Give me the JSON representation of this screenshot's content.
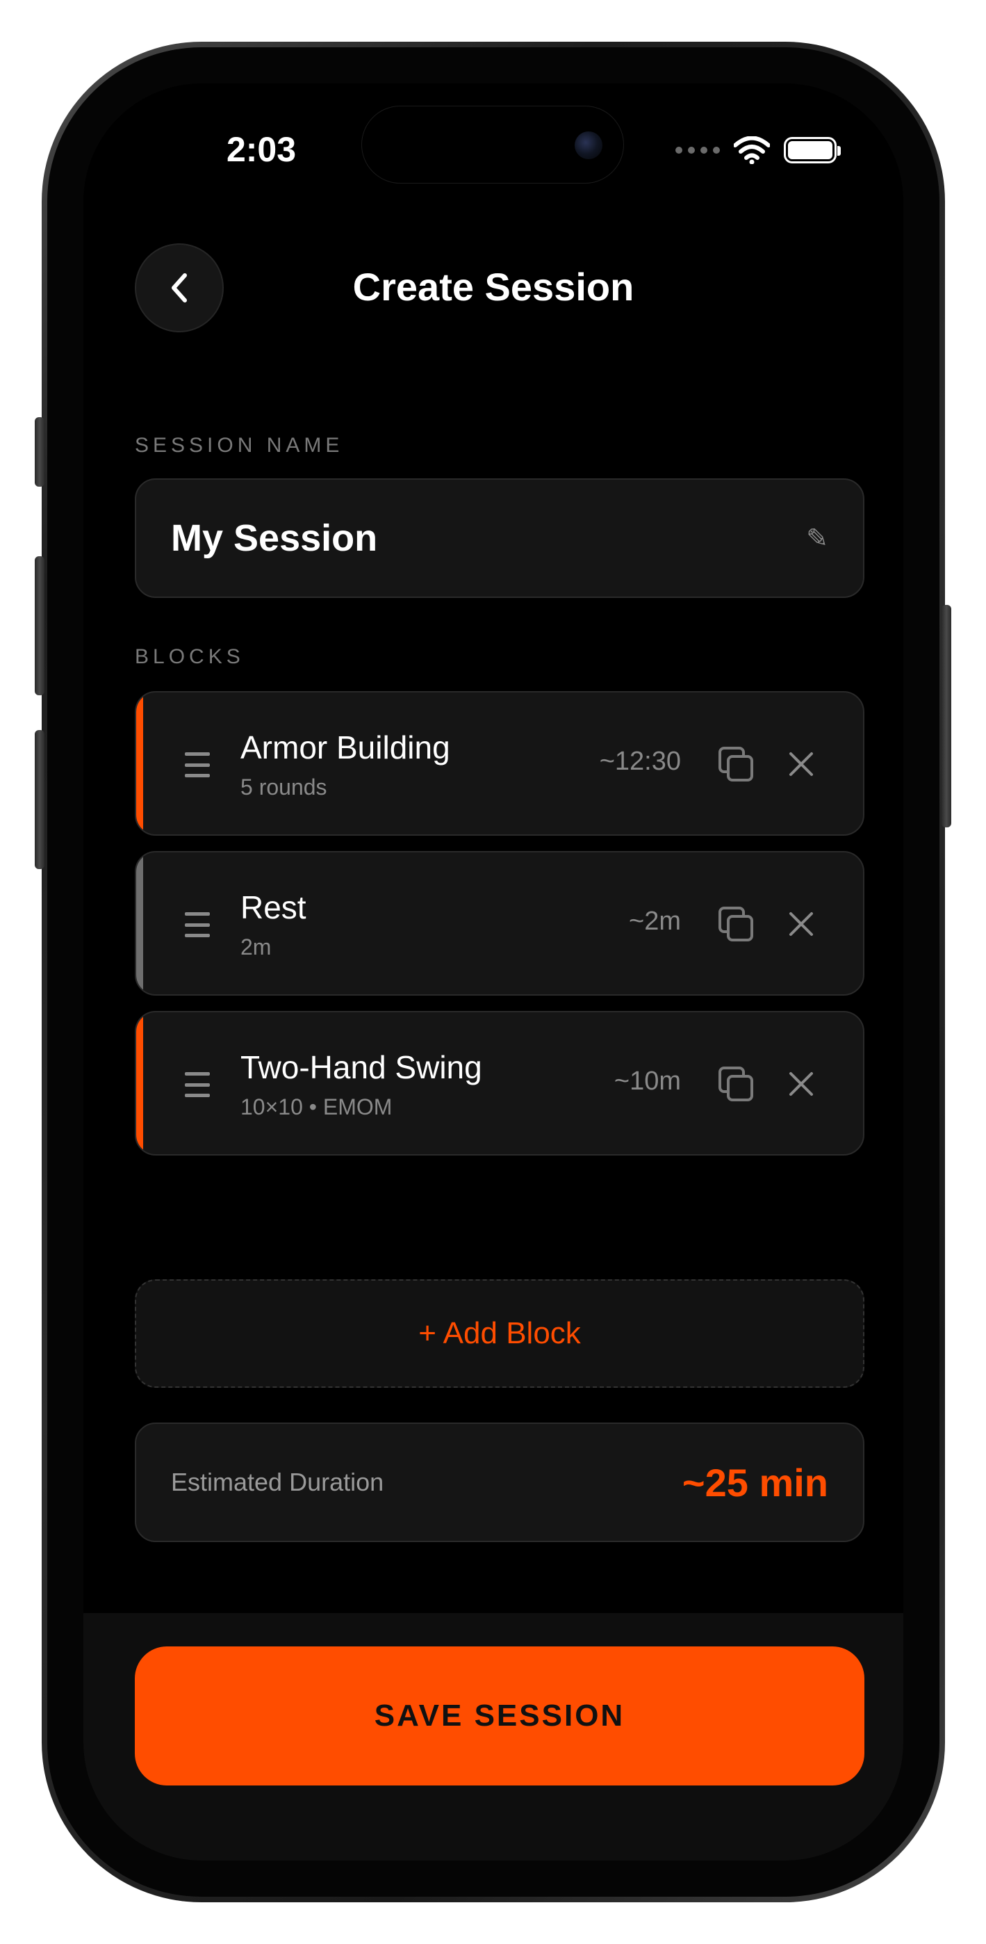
{
  "status_bar": {
    "time": "2:03"
  },
  "header": {
    "title": "Create Session",
    "back_icon": "chevron-left-icon"
  },
  "session_name": {
    "label": "SESSION NAME",
    "value": "My Session",
    "edit_icon": "pencil-icon"
  },
  "blocks": {
    "label": "BLOCKS",
    "items": [
      {
        "title": "Armor Building",
        "subtitle": "5 rounds",
        "duration": "~12:30",
        "accent_color": "#ff4d00"
      },
      {
        "title": "Rest",
        "subtitle": "2m",
        "duration": "~2m",
        "accent_color": "#6e6e6e"
      },
      {
        "title": "Two-Hand Swing",
        "subtitle": "10×10 • EMOM",
        "duration": "~10m",
        "accent_color": "#ff4d00"
      }
    ]
  },
  "add_block": {
    "label": "+ Add Block"
  },
  "estimate": {
    "label": "Estimated Duration",
    "value": "~25 min"
  },
  "save_button": {
    "label": "SAVE SESSION"
  },
  "colors": {
    "accent": "#ff4d00",
    "background": "#000000",
    "card": "#151515"
  }
}
